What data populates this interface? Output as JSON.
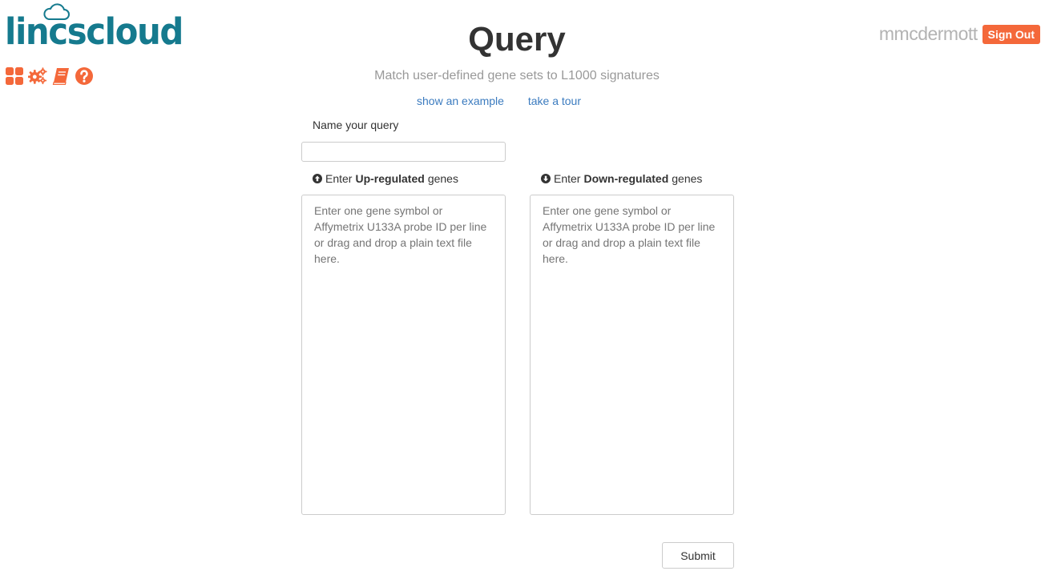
{
  "header": {
    "logo_text": "lincscloud",
    "title": "Query",
    "subtitle": "Match user-defined gene sets to L1000 signatures",
    "username": "mmcdermott",
    "sign_out_label": "Sign Out"
  },
  "toolbar": {
    "icons": [
      "apps-grid-icon",
      "settings-gears-icon",
      "book-icon",
      "help-icon"
    ]
  },
  "links": {
    "example": "show an example",
    "tour": "take a tour"
  },
  "form": {
    "name_label": "Name your query",
    "name_value": "",
    "up": {
      "prefix": "Enter ",
      "bold": "Up-regulated",
      "suffix": " genes",
      "placeholder": "Enter one gene symbol or Affymetrix U133A probe ID per line or drag and drop a plain text file here."
    },
    "down": {
      "prefix": "Enter ",
      "bold": "Down-regulated",
      "suffix": " genes",
      "placeholder": "Enter one gene symbol or Affymetrix U133A probe ID per line or drag and drop a plain text file here."
    },
    "submit_label": "Submit"
  },
  "colors": {
    "brand_teal": "#157a8e",
    "accent_orange": "#f4683a",
    "link_blue": "#3b7bbf"
  }
}
